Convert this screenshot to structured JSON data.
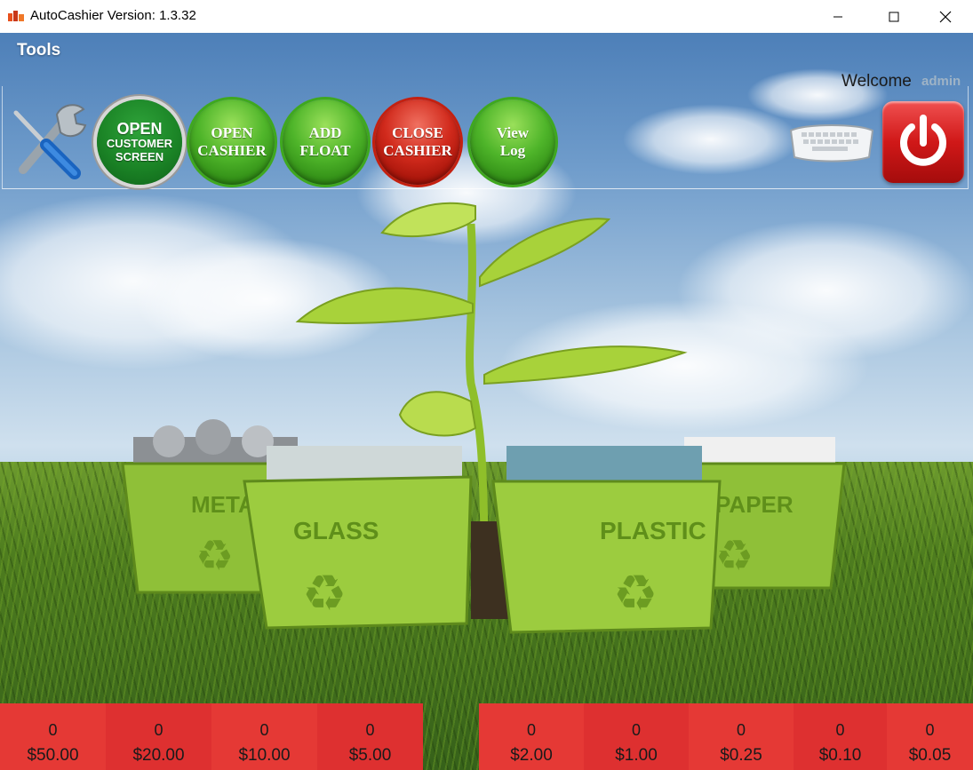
{
  "window": {
    "title": "AutoCashier Version: 1.3.32",
    "controls": [
      "minimize",
      "maximize",
      "close"
    ]
  },
  "toolbar": {
    "menu_label": "Tools",
    "buttons": [
      {
        "id": "open-customer-screen",
        "lines": [
          "OPEN",
          "CUSTOMER",
          "SCREEN"
        ],
        "color": "#1b8426"
      },
      {
        "id": "open-cashier",
        "lines": [
          "OPEN",
          "CASHIER"
        ],
        "color": "#4fb52a"
      },
      {
        "id": "add-float",
        "lines": [
          "ADD",
          "FLOAT"
        ],
        "color": "#4fb52a"
      },
      {
        "id": "close-cashier",
        "lines": [
          "CLOSE",
          "CASHIER"
        ],
        "color": "#d12a1c"
      },
      {
        "id": "view-log",
        "lines": [
          "View",
          "Log"
        ],
        "color": "#4fb52a"
      }
    ],
    "welcome_text": "Welcome",
    "username": "admin"
  },
  "scene": {
    "bin_labels": [
      "METAL",
      "GLASS",
      "PLASTIC",
      "PAPER"
    ]
  },
  "denominations_left": [
    {
      "count": "0",
      "value": "$50.00"
    },
    {
      "count": "0",
      "value": "$20.00"
    },
    {
      "count": "0",
      "value": "$10.00"
    },
    {
      "count": "0",
      "value": "$5.00"
    }
  ],
  "denominations_right": [
    {
      "count": "0",
      "value": "$2.00"
    },
    {
      "count": "0",
      "value": "$1.00"
    },
    {
      "count": "0",
      "value": "$0.25"
    },
    {
      "count": "0",
      "value": "$0.10"
    },
    {
      "count": "0",
      "value": "$0.05"
    }
  ],
  "colors": {
    "denom_bar": "#e53935",
    "green_button": "#4fb52a",
    "red_button": "#d12a1c"
  }
}
